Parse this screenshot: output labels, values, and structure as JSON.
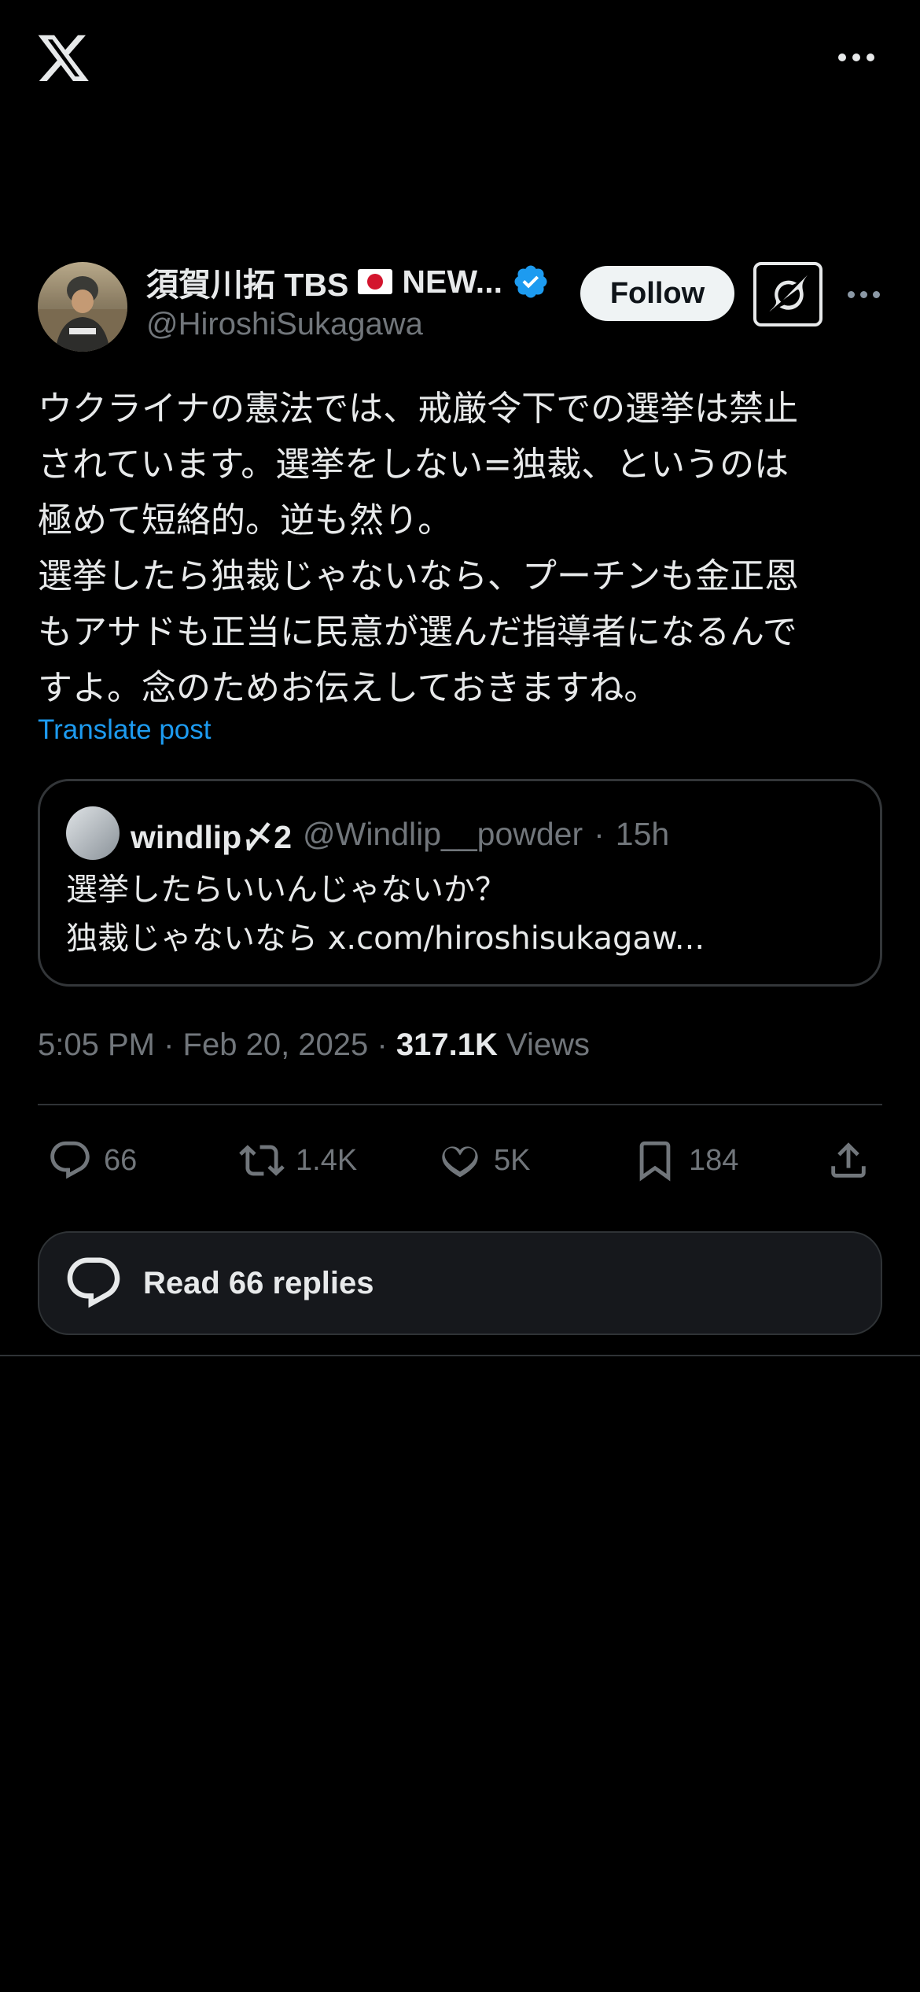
{
  "header": {
    "logo_icon": "x-logo-icon",
    "more_icon": "more-horizontal-icon"
  },
  "author": {
    "display_name": "須賀川拓 TBS",
    "name_suffix": "NEW...",
    "flag": "japan-flag-emoji",
    "verified_color": "#1d9bf0",
    "handle": "@HiroshiSukagawa",
    "follow_label": "Follow"
  },
  "post": {
    "text": "ウクライナの憲法では、戒厳令下での選挙は禁止\nされています。選挙をしない=独裁、というのは\n極めて短絡的。逆も然り。\n選挙したら独裁じゃないなら、プーチンも金正恩\nもアサドも正当に民意が選んだ指導者になるんで\nすよ。念のためお伝えしておきますね。",
    "translate_label": "Translate post"
  },
  "quoted_post": {
    "name": "windlip〆2",
    "handle": "@Windlip__powder",
    "separator": "·",
    "age": "15h",
    "text": "選挙したらいいんじゃないか？\n独裁じゃないなら x.com/hiroshisukagaw..."
  },
  "meta": {
    "time": "5:05 PM",
    "dot1": "·",
    "date": "Feb 20, 2025",
    "dot2": "·",
    "views_count": "317.1K",
    "views_label": "Views"
  },
  "actions": {
    "replies": "66",
    "reposts": "1.4K",
    "likes": "5K",
    "bookmarks": "184"
  },
  "read_replies_label": "Read 66 replies",
  "colors": {
    "background": "#000000",
    "accent": "#1d9bf0",
    "muted": "#71767b",
    "text": "#e7e9ea"
  }
}
